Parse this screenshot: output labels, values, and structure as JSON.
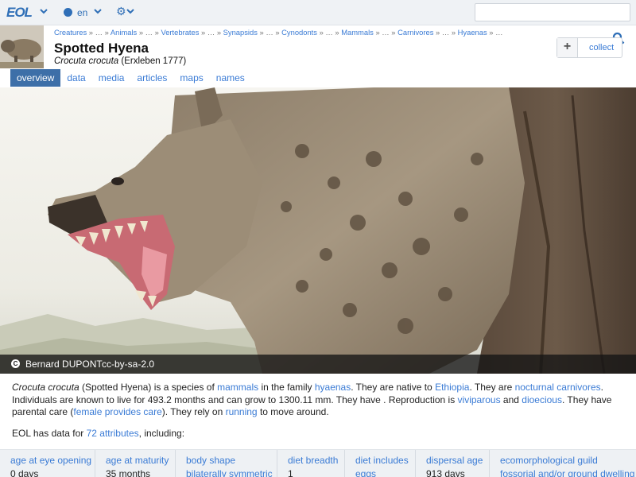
{
  "nav": {
    "logo": "EOL",
    "language": "en"
  },
  "breadcrumb": [
    "Creatures",
    "Animals",
    "Vertebrates",
    "Synapsids",
    "Cynodonts",
    "Mammals",
    "Carnivores",
    "Hyaenas"
  ],
  "breadcrumb_ellipsis": "…",
  "breadcrumb_separator": "»",
  "page": {
    "title": "Spotted Hyena",
    "sci_name": "Crocuta crocuta",
    "authority": "(Erxleben 1777)"
  },
  "collect": {
    "plus": "+",
    "label": "collect"
  },
  "tabs": [
    "overview",
    "data",
    "media",
    "articles",
    "maps",
    "names"
  ],
  "image": {
    "author": "Bernard DUPONT",
    "license": "cc-by-sa-2.0",
    "license_icon": "C"
  },
  "summary": {
    "s1": "Crocuta crocuta",
    "s2": " (Spotted Hyena) is a species of ",
    "l_mammals": "mammals",
    "s3": " in the family ",
    "l_hyaenas": "hyaenas",
    "s4": ". They are native to ",
    "l_ethiopia": "Ethiopia",
    "s5": ". They are ",
    "l_nocturnal": "nocturnal",
    "s6": " ",
    "l_carnivores": "carnivores",
    "s7": ". Individuals are known to live for 493.2 months and can grow to 1300.11 mm. They have . Reproduction is ",
    "l_viviparous": "viviparous",
    "s8": " and ",
    "l_dioecious": "dioecious",
    "s9": ". They have parental care (",
    "l_female_care": "female provides care",
    "s10": "). They rely on ",
    "l_running": "running",
    "s11": " to move around."
  },
  "hasdata": {
    "prefix": "EOL has data for ",
    "link": "72 attributes",
    "suffix": ", including:"
  },
  "attributes": [
    {
      "name": "age at eye opening",
      "value": "0 days"
    },
    {
      "name": "age at maturity",
      "value": "35 months"
    },
    {
      "name": "body shape",
      "value": "bilaterally symmetric"
    },
    {
      "name": "diet breadth",
      "value": "1"
    },
    {
      "name": "diet includes",
      "value": "eggs"
    },
    {
      "name": "dispersal age",
      "value": "913 days"
    },
    {
      "name": "ecomorphological guild",
      "value": "fossorial and/or ground dwelling"
    }
  ],
  "colors": {
    "link": "#3a7bd5",
    "tab_active": "#3d6fa8",
    "nav_bg": "#eff2f5"
  }
}
